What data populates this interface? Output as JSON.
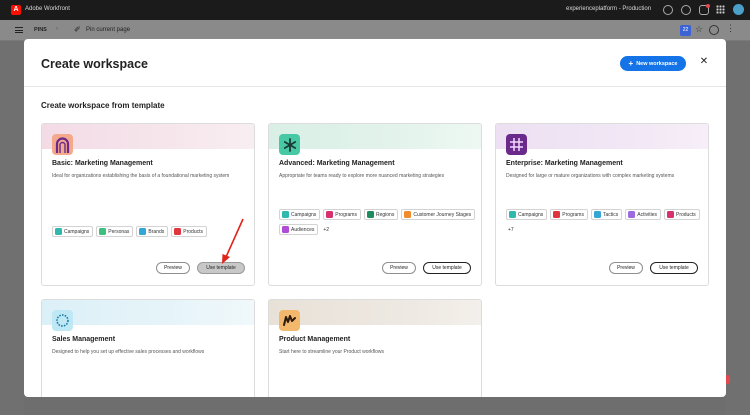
{
  "appbar": {
    "app_name": "Adobe Workfront",
    "logo_letter": "A",
    "org_label": "experienceplatform - Production",
    "icons": [
      "feedback-icon",
      "help-icon",
      "notification-icon",
      "app-switcher-icon",
      "user-avatar"
    ]
  },
  "pinsbar": {
    "pins_label": "PINS",
    "chevron": "›",
    "pin_icon": "✐",
    "pin_current_label": "Pin current page",
    "calendar_day": "22",
    "star": "☆",
    "more": "⋮"
  },
  "modal": {
    "title": "Create workspace",
    "new_workspace_label": "New workspace",
    "new_workspace_plus": "+",
    "close_label": "✕",
    "section_title": "Create workspace from template"
  },
  "cards": [
    {
      "title": "Basic: Marketing Management",
      "description": "Ideal for organizations establishing the basis of a foundational marketing system",
      "banner_color": "#f7e3ea",
      "icon_color": "#f4a88c",
      "tags": [
        {
          "label": "Campaigns",
          "color": "#2fb8ad"
        },
        {
          "label": "Personas",
          "color": "#3fbf7f"
        },
        {
          "label": "Brands",
          "color": "#33a6d6"
        },
        {
          "label": "Products",
          "color": "#e0353c"
        }
      ],
      "preview_label": "Preview",
      "use_label": "Use template"
    },
    {
      "title": "Advanced: Marketing Management",
      "description": "Appropriate for teams ready to explore more nuanced marketing strategies",
      "banner_color": "#dff1ea",
      "icon_color": "#48c9a5",
      "tags": [
        {
          "label": "Campaigns",
          "color": "#2fb8ad"
        },
        {
          "label": "Programs",
          "color": "#d6306f"
        },
        {
          "label": "Regions",
          "color": "#1e8c5e"
        },
        {
          "label": "Customer Journey Stages",
          "color": "#f08c2b"
        },
        {
          "label": "Audiences",
          "color": "#b04cd6"
        }
      ],
      "more_label": "+2",
      "preview_label": "Preview",
      "use_label": "Use template"
    },
    {
      "title": "Enterprise: Marketing Management",
      "description": "Designed for large or mature organizations with complex marketing systems",
      "banner_color": "#efe3f3",
      "icon_color": "#6a2a8c",
      "tags": [
        {
          "label": "Campaigns",
          "color": "#2fb8ad"
        },
        {
          "label": "Programs",
          "color": "#e0353c"
        },
        {
          "label": "Tactics",
          "color": "#33a6d6"
        },
        {
          "label": "Activities",
          "color": "#9b6ce0"
        },
        {
          "label": "Products",
          "color": "#d6306f"
        }
      ],
      "more_label": "+7",
      "preview_label": "Preview",
      "use_label": "Use template"
    },
    {
      "title": "Sales Management",
      "description": "Designed to help you set up effective sales processes and workflows",
      "banner_color": "#e3f2f8",
      "icon_color": "#9fdcef"
    },
    {
      "title": "Product Management",
      "description": "Start here to streamline your Product workflows",
      "banner_color": "#ebe6df",
      "icon_color": "#f2b86b"
    }
  ]
}
